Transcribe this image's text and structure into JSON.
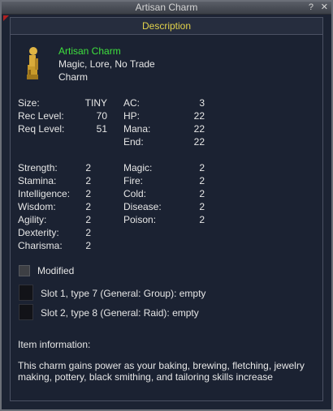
{
  "window": {
    "title": "Artisan Charm",
    "help_label": "?",
    "close_label": "✕",
    "tab_label": "Description"
  },
  "item": {
    "name": "Artisan Charm",
    "flags": "Magic, Lore, No Trade",
    "slot": "Charm",
    "icon": "artisan-charm-statuette-icon"
  },
  "stats_left": [
    {
      "label": "Size:",
      "value": "TINY"
    },
    {
      "label": "Rec Level:",
      "value": "70"
    },
    {
      "label": "Req Level:",
      "value": "51"
    }
  ],
  "stats_right": [
    {
      "label": "AC:",
      "value": "3"
    },
    {
      "label": "HP:",
      "value": "22"
    },
    {
      "label": "Mana:",
      "value": "22"
    },
    {
      "label": "End:",
      "value": "22"
    }
  ],
  "attributes": [
    {
      "label": "Strength:",
      "value": "2"
    },
    {
      "label": "Stamina:",
      "value": "2"
    },
    {
      "label": "Intelligence:",
      "value": "2"
    },
    {
      "label": "Wisdom:",
      "value": "2"
    },
    {
      "label": "Agility:",
      "value": "2"
    },
    {
      "label": "Dexterity:",
      "value": "2"
    },
    {
      "label": "Charisma:",
      "value": "2"
    }
  ],
  "resists": [
    {
      "label": "Magic:",
      "value": "2"
    },
    {
      "label": "Fire:",
      "value": "2"
    },
    {
      "label": "Cold:",
      "value": "2"
    },
    {
      "label": "Disease:",
      "value": "2"
    },
    {
      "label": "Poison:",
      "value": "2"
    }
  ],
  "modified_label": "Modified",
  "augment_slots": [
    {
      "label": "Slot 1, type 7 (General: Group): empty"
    },
    {
      "label": "Slot 2, type 8 (General: Raid): empty"
    }
  ],
  "info": {
    "heading": "Item information:",
    "text": "This charm gains power as your baking, brewing, fletching, jewelry making, pottery, black smithing, and tailoring skills increase"
  },
  "colors": {
    "name_green": "#3ee03e",
    "tab_yellow": "#e2d24a",
    "background": "#1c2333"
  }
}
